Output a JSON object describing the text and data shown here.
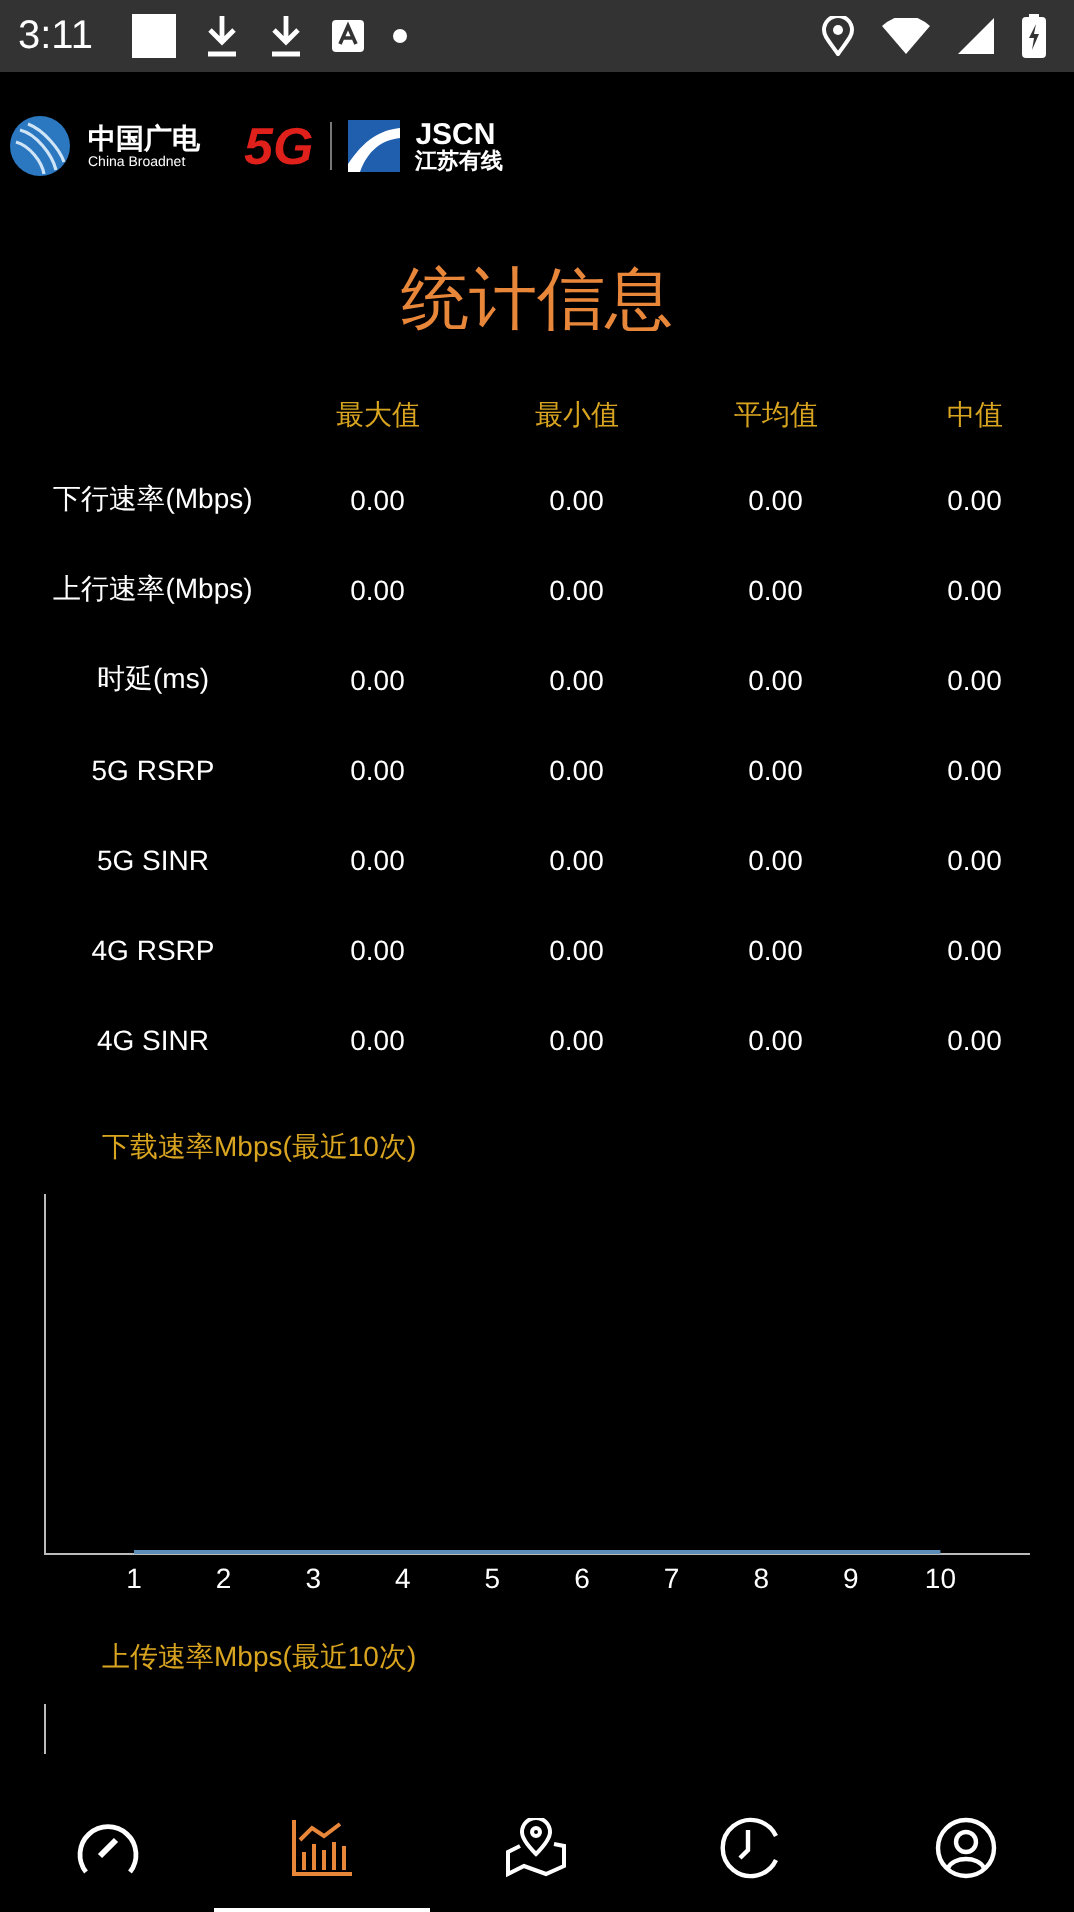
{
  "status_bar": {
    "time": "3:11"
  },
  "brand": {
    "cn_name": "中国广电",
    "en_name": "China Broadnet",
    "badge": "5G",
    "jscn": "JSCN",
    "jscn_cn": "江苏有线"
  },
  "title": "统计信息",
  "table": {
    "columns": [
      "最大值",
      "最小值",
      "平均值",
      "中值"
    ],
    "rows": [
      {
        "label": "下行速率(Mbps)",
        "values": [
          "0.00",
          "0.00",
          "0.00",
          "0.00"
        ]
      },
      {
        "label": "上行速率(Mbps)",
        "values": [
          "0.00",
          "0.00",
          "0.00",
          "0.00"
        ]
      },
      {
        "label": "时延(ms)",
        "values": [
          "0.00",
          "0.00",
          "0.00",
          "0.00"
        ]
      },
      {
        "label": "5G RSRP",
        "values": [
          "0.00",
          "0.00",
          "0.00",
          "0.00"
        ]
      },
      {
        "label": "5G SINR",
        "values": [
          "0.00",
          "0.00",
          "0.00",
          "0.00"
        ]
      },
      {
        "label": "4G RSRP",
        "values": [
          "0.00",
          "0.00",
          "0.00",
          "0.00"
        ]
      },
      {
        "label": "4G SINR",
        "values": [
          "0.00",
          "0.00",
          "0.00",
          "0.00"
        ]
      }
    ]
  },
  "charts": [
    {
      "title": "下载速率Mbps(最近10次)",
      "x_labels": [
        "1",
        "2",
        "3",
        "4",
        "5",
        "6",
        "7",
        "8",
        "9",
        "10"
      ]
    },
    {
      "title": "上传速率Mbps(最近10次)"
    }
  ],
  "nav": [
    {
      "kind": "speed",
      "selected": false
    },
    {
      "kind": "stats",
      "selected": true
    },
    {
      "kind": "map",
      "selected": false
    },
    {
      "kind": "history",
      "selected": false
    },
    {
      "kind": "user",
      "selected": false
    }
  ]
}
